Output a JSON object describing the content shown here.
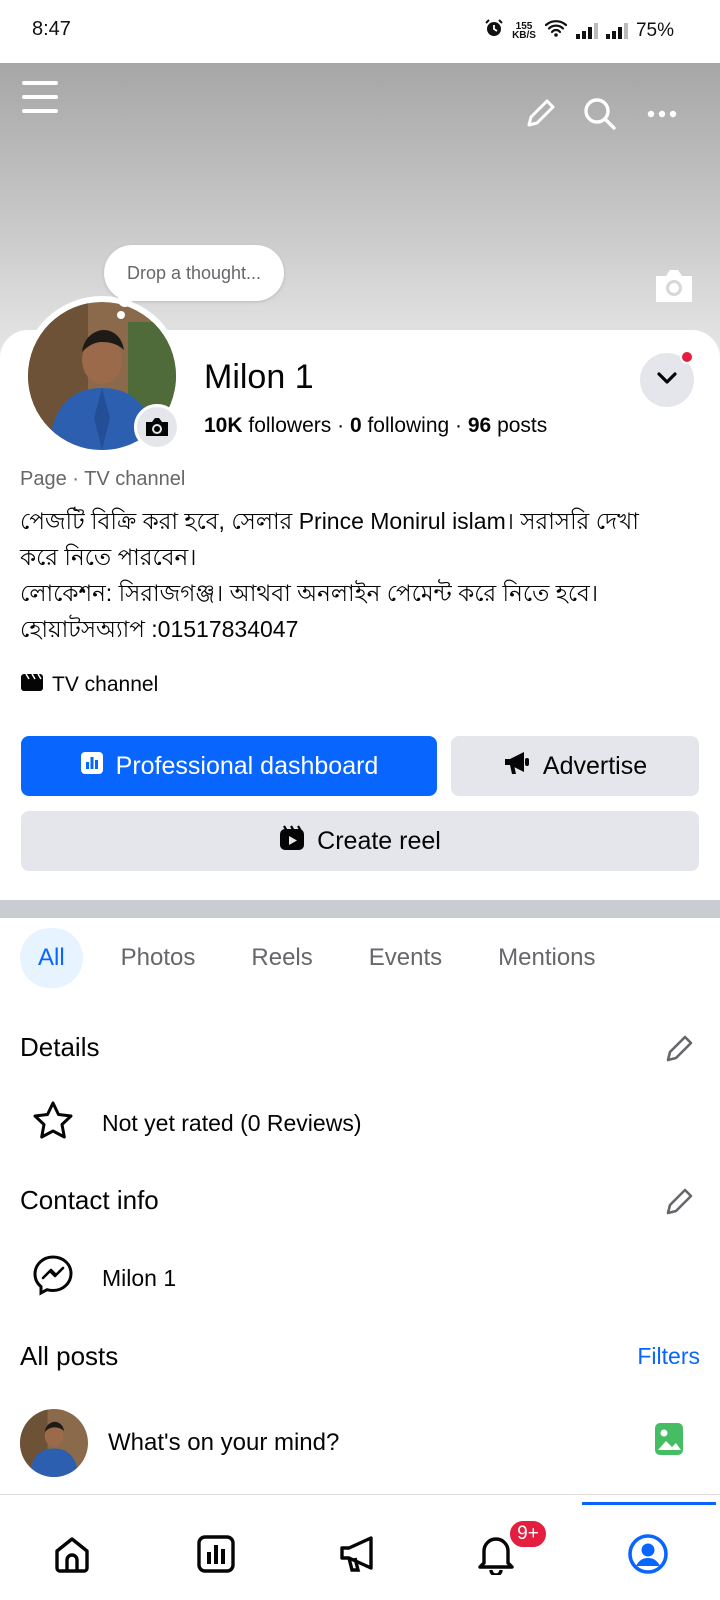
{
  "status_bar": {
    "time": "8:47",
    "speed_top": "155",
    "speed_bottom": "KB/S",
    "battery": "75%"
  },
  "cover": {
    "thought_placeholder": "Drop a thought..."
  },
  "profile": {
    "name": "Milon 1",
    "followers_count": "10K",
    "followers_label": "followers",
    "following_count": "0",
    "following_label": "following",
    "posts_count": "96",
    "posts_label": "posts",
    "separator": "·",
    "category": "Page · TV channel",
    "bio_lines": [
      "পেজটি বিক্রি করা হবে, সেলার Prince Monirul islam। সরাসরি দেখা",
      "করে নিতে পারবেন।",
      "লোকেশন: সিরাজগঞ্জ। আথবা অনলাইন পেমেন্ট করে নিতে হবে।",
      "হোয়াটসঅ্যাপ :01517834047"
    ],
    "channel_type": "TV channel"
  },
  "actions": {
    "professional_dashboard": "Professional dashboard",
    "advertise": "Advertise",
    "create_reel": "Create reel"
  },
  "tabs": [
    {
      "label": "All",
      "active": true
    },
    {
      "label": "Photos",
      "active": false
    },
    {
      "label": "Reels",
      "active": false
    },
    {
      "label": "Events",
      "active": false
    },
    {
      "label": "Mentions",
      "active": false
    }
  ],
  "details": {
    "title": "Details",
    "rating_text": "Not yet rated (0 Reviews)"
  },
  "contact": {
    "title": "Contact info",
    "messenger_name": "Milon 1"
  },
  "posts": {
    "title": "All posts",
    "filters_label": "Filters",
    "compose_placeholder": "What's on your mind?"
  },
  "bottom_nav": {
    "notifications_badge": "9+"
  },
  "colors": {
    "accent": "#0866ff",
    "badge": "#e41e3f",
    "secondary_bg": "#e4e6eb",
    "photo_green": "#45bd62"
  }
}
